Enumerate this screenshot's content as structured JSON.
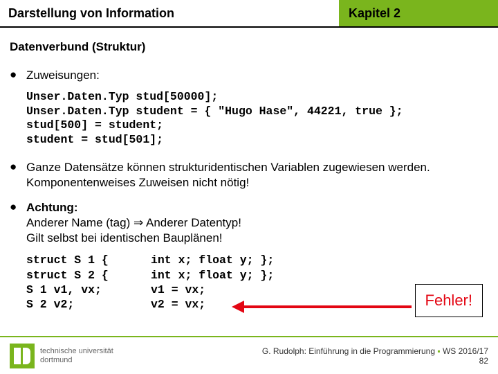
{
  "header": {
    "left": "Darstellung von Information",
    "right": "Kapitel 2"
  },
  "subtitle": "Datenverbund (Struktur)",
  "bullets": {
    "b1": "Zuweisungen:",
    "b2": "Ganze Datensätze können strukturidentischen Variablen zugewiesen werden. Komponentenweises Zuweisen nicht nötig!",
    "b3_strong": "Achtung:",
    "b3_l2a": "Anderer Name (tag) ",
    "b3_l2b": " Anderer Datentyp!",
    "b3_l3": "Gilt selbst bei identischen Bauplänen!"
  },
  "code1": "Unser.Daten.Typ stud[50000];\nUnser.Daten.Typ student = { \"Hugo Hase\", 44221, true };\nstud[500] = student;\nstudent = stud[501];",
  "code2": {
    "r1c1": "struct S 1 {",
    "r1c2": "int x; float y; };",
    "r2c1": "struct S 2 {",
    "r2c2": "int x; float y; };",
    "r3c1": "S 1 v1, vx;",
    "r3c2": "v1 = vx;",
    "r4c1": "S 2 v2;",
    "r4c2": "v2 = vx;"
  },
  "fehler": "Fehler!",
  "logo": {
    "line1": "technische universität",
    "line2": "dortmund"
  },
  "footer": {
    "text": "G. Rudolph: Einführung in die Programmierung ",
    "sep": "▪",
    "sem": " WS 2016/17",
    "page": "82"
  }
}
